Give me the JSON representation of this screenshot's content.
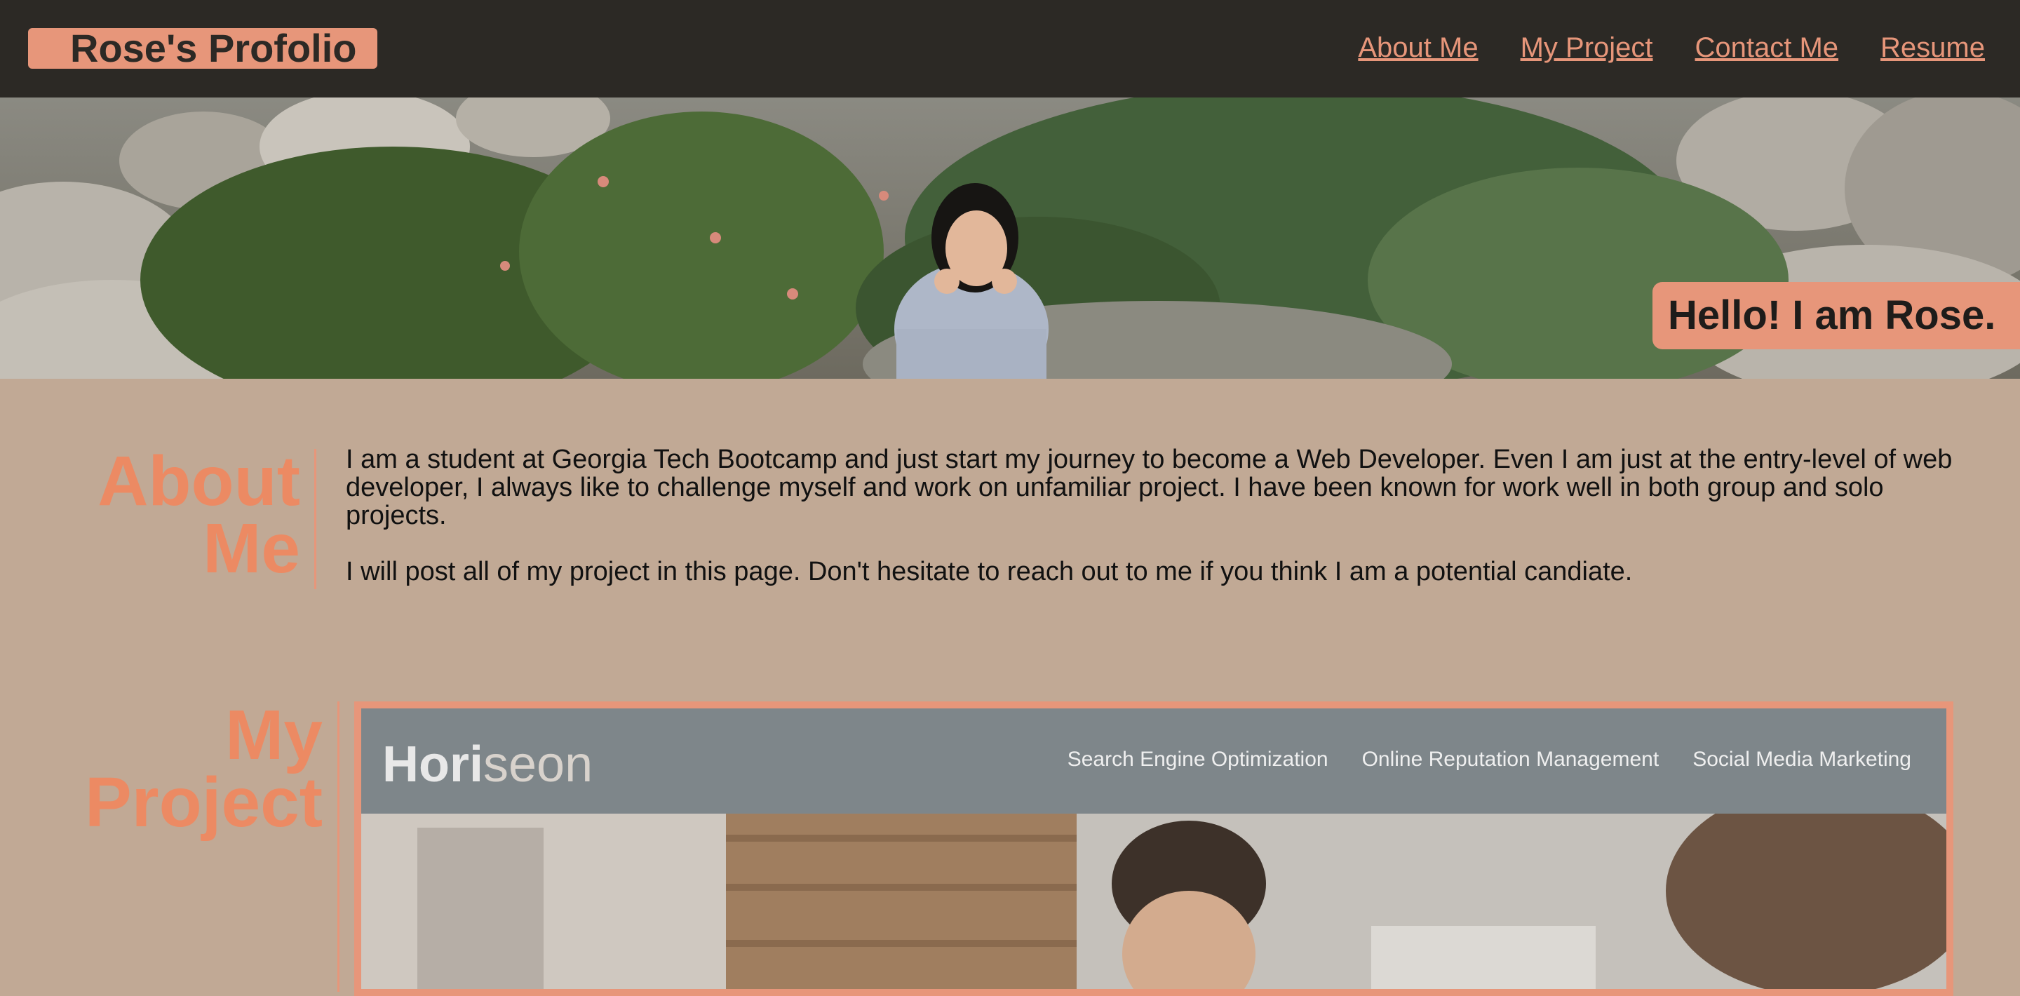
{
  "header": {
    "brand": "Rose's Profolio",
    "nav": [
      "About Me",
      "My Project",
      "Contact Me",
      "Resume"
    ]
  },
  "hero": {
    "tagline": "Hello! I am Rose."
  },
  "about": {
    "title_line1": "About",
    "title_line2": "Me",
    "paragraph1": "I am a student at Georgia Tech Bootcamp and just start my journey to become a Web Developer. Even I am just at the entry-level of web developer, I always like to challenge myself and work on unfamiliar project. I have been known for work well in both group and solo projects.",
    "paragraph2": "I will post all of my project in this page. Don't hesitate to reach out to me if you think I am a potential candiate."
  },
  "project": {
    "title_line1": "My",
    "title_line2": "Project",
    "card": {
      "logo_bold": "Hori",
      "logo_rest": "seon",
      "nav": [
        "Search Engine Optimization",
        "Online Reputation Management",
        "Social Media Marketing"
      ]
    }
  },
  "colors": {
    "header_bg": "#2c2925",
    "accent": "#e7967a",
    "heading": "#ec8a63",
    "page_bg": "#c1a995",
    "card_header": "#7e868a"
  }
}
